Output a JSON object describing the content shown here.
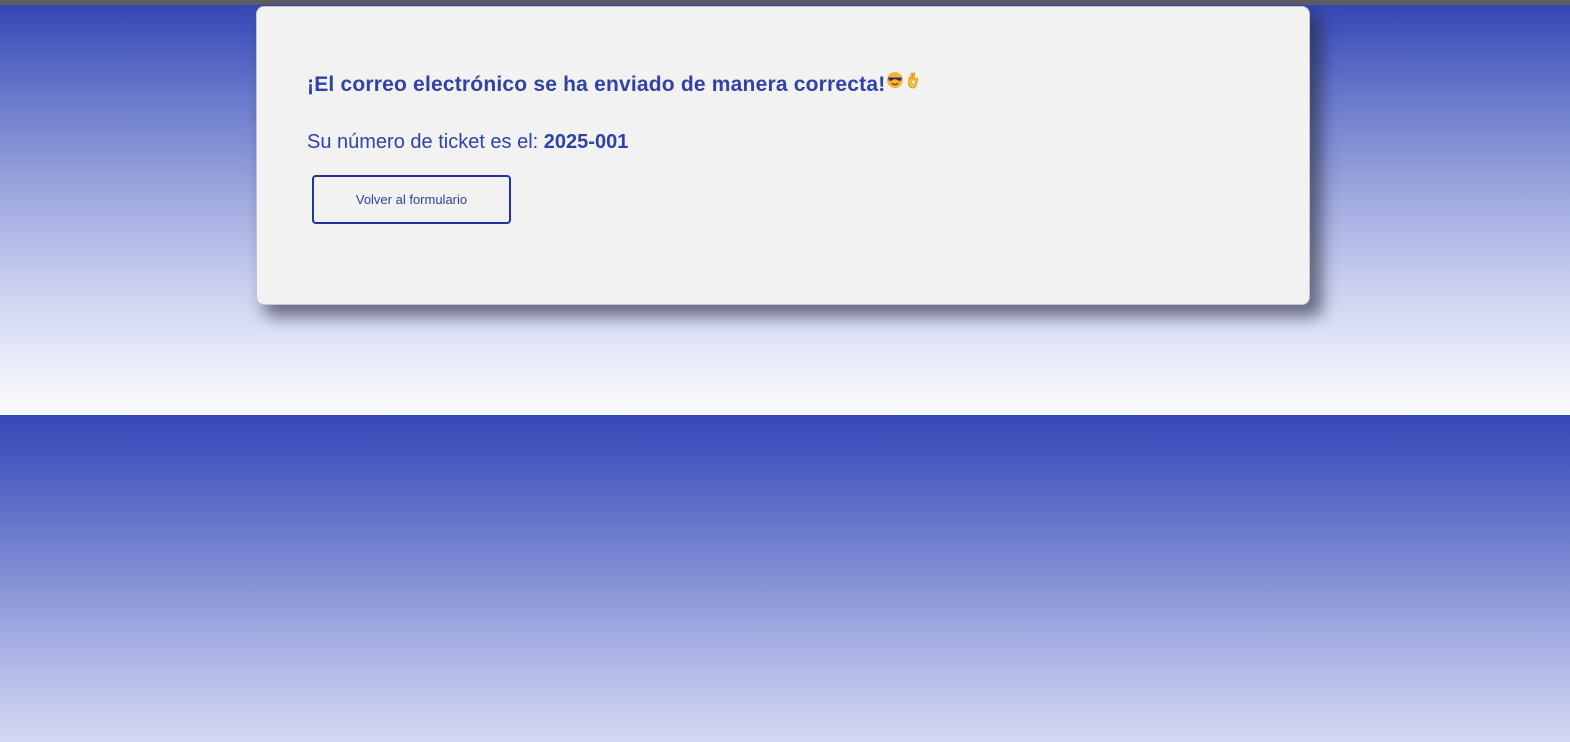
{
  "confirmation": {
    "title": "¡El correo electrónico se ha enviado de manera correcta!",
    "title_icons": [
      "sunglasses-face-icon",
      "ok-hand-icon"
    ],
    "ticket_label": "Su número de ticket es el: ",
    "ticket_number": "2025-001",
    "back_button_label": "Volver al formulario"
  },
  "colors": {
    "accent": "#2f42a8",
    "button_border": "#24339c",
    "card_background": "#f2f2f3",
    "gradient_top": "#3447b6"
  }
}
